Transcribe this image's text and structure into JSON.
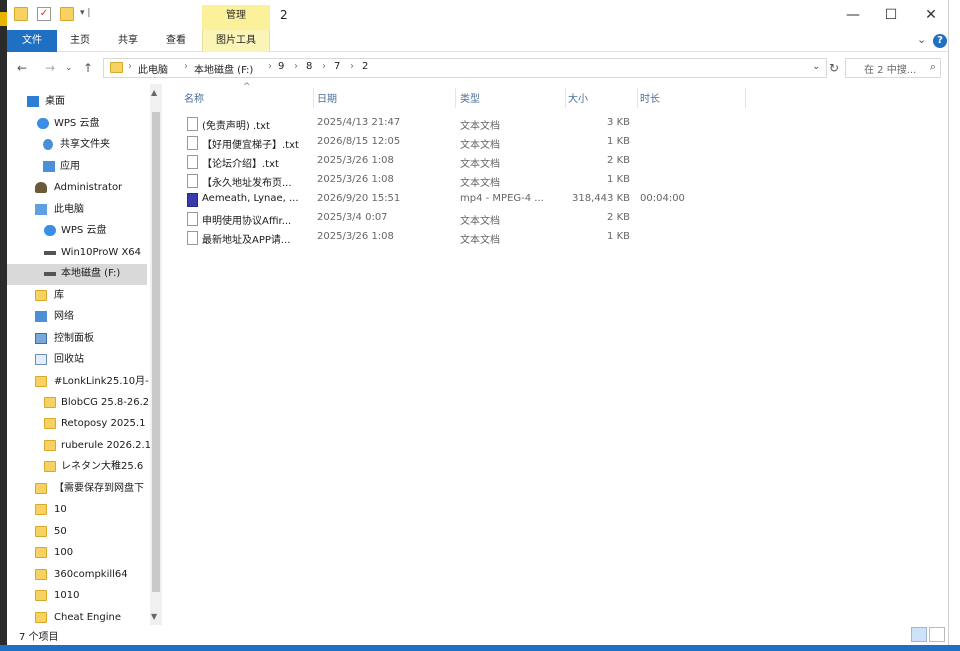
{
  "window": {
    "title": "2"
  },
  "ribbon": {
    "manage": "管理",
    "tabs": [
      "文件",
      "主页",
      "共享",
      "查看",
      "图片工具"
    ]
  },
  "address": {
    "crumbs": [
      "此电脑",
      "本地磁盘 (F:)",
      "9",
      "8",
      "7",
      "2"
    ],
    "search_placeholder": "在 2 中搜..."
  },
  "sidebar": {
    "items": [
      {
        "label": "桌面",
        "icon": "desktop-icon"
      },
      {
        "label": "WPS 云盘",
        "icon": "cloud-icon"
      },
      {
        "label": "共享文件夹",
        "icon": "share-icon"
      },
      {
        "label": "应用",
        "icon": "apps-icon"
      },
      {
        "label": "Administrator",
        "icon": "user-icon"
      },
      {
        "label": "此电脑",
        "icon": "computer-icon"
      },
      {
        "label": "WPS 云盘",
        "icon": "cloud-icon"
      },
      {
        "label": "Win10ProW X64",
        "icon": "drive-icon"
      },
      {
        "label": "本地磁盘 (F:)",
        "icon": "drive-icon"
      },
      {
        "label": "库",
        "icon": "library-icon"
      },
      {
        "label": "网络",
        "icon": "network-icon"
      },
      {
        "label": "控制面板",
        "icon": "control-panel-icon"
      },
      {
        "label": "回收站",
        "icon": "recycle-bin-icon"
      },
      {
        "label": "#LonkLink25.10月-",
        "icon": "folder-icon"
      },
      {
        "label": "BlobCG 25.8-26.2",
        "icon": "folder-icon"
      },
      {
        "label": "Retoposy 2025.1",
        "icon": "folder-icon"
      },
      {
        "label": "ruberule 2026.2.1",
        "icon": "folder-icon"
      },
      {
        "label": "レネタン大稚25.6",
        "icon": "folder-icon"
      },
      {
        "label": "【需要保存到网盘下",
        "icon": "folder-icon"
      },
      {
        "label": "10",
        "icon": "folder-icon"
      },
      {
        "label": "50",
        "icon": "folder-icon"
      },
      {
        "label": "100",
        "icon": "folder-icon"
      },
      {
        "label": "360compkill64",
        "icon": "folder-icon"
      },
      {
        "label": "1010",
        "icon": "folder-icon"
      },
      {
        "label": "Cheat Engine",
        "icon": "folder-icon"
      }
    ]
  },
  "columns": {
    "name": "名称",
    "date": "日期",
    "type": "类型",
    "size": "大小",
    "duration": "时长"
  },
  "files": [
    {
      "name": "(免责声明) .txt",
      "date": "2025/4/13 21:47",
      "type": "文本文档",
      "size": "3 KB",
      "duration": ""
    },
    {
      "name": "【好用便宜梯子】.txt",
      "date": "2026/8/15 12:05",
      "type": "文本文档",
      "size": "1 KB",
      "duration": ""
    },
    {
      "name": "【论坛介绍】.txt",
      "date": "2025/3/26 1:08",
      "type": "文本文档",
      "size": "2 KB",
      "duration": ""
    },
    {
      "name": "【永久地址发布页...",
      "date": "2025/3/26 1:08",
      "type": "文本文档",
      "size": "1 KB",
      "duration": ""
    },
    {
      "name": "Aemeath, Lynae, ...",
      "date": "2026/9/20 15:51",
      "type": "mp4 - MPEG-4 ...",
      "size": "318,443 KB",
      "duration": "00:04:00"
    },
    {
      "name": "申明使用协议Affir...",
      "date": "2025/3/4 0:07",
      "type": "文本文档",
      "size": "2 KB",
      "duration": ""
    },
    {
      "name": "最新地址及APP请...",
      "date": "2025/3/26 1:08",
      "type": "文本文档",
      "size": "1 KB",
      "duration": ""
    }
  ],
  "status": {
    "count": "7 个项目"
  }
}
